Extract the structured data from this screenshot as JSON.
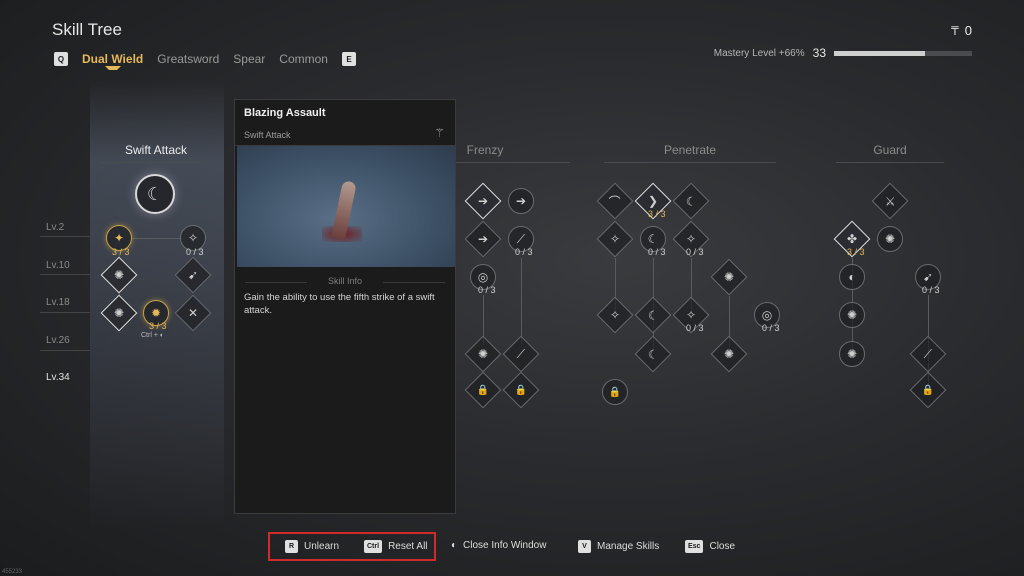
{
  "header": {
    "title": "Skill Tree",
    "currency_symbol": "₸",
    "currency_value": "0",
    "tabs": {
      "prev_key": "Q",
      "next_key": "E",
      "items": [
        "Dual Wield",
        "Greatsword",
        "Spear",
        "Common"
      ],
      "active": "Dual Wield"
    },
    "mastery": {
      "label": "Mastery Level +66%",
      "level": "33",
      "progress": 0.66
    }
  },
  "levels": [
    "Lv.2",
    "Lv.10",
    "Lv.18",
    "Lv.26",
    "Lv.34"
  ],
  "columns": {
    "swift_attack": "Swift Attack",
    "frenzy": "Frenzy",
    "penetrate": "Penetrate",
    "guard": "Guard"
  },
  "counts": {
    "c33": "3 / 3",
    "c03": "0 / 3"
  },
  "info_panel": {
    "skill_name": "Blazing Assault",
    "category": "Swift Attack",
    "section_label": "Skill Info",
    "description": "Gain the ability to use the fifth strike of a swift attack."
  },
  "footer": {
    "unlearn_key": "R",
    "unlearn_label": "Unlearn",
    "reset_key": "Ctrl",
    "reset_label": "Reset All",
    "close_info_label": "Close Info Window",
    "manage_key": "V",
    "manage_label": "Manage Skills",
    "close_key": "Esc",
    "close_label": "Close"
  },
  "combo_hint": "Ctrl + ◐",
  "build_id": "455233",
  "colors": {
    "accent_gold": "#e5b85a",
    "highlight_red": "#d12a2a"
  }
}
